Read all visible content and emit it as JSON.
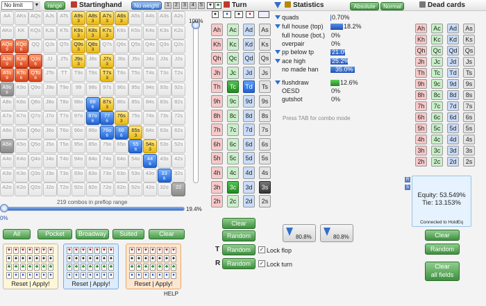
{
  "topbar": {
    "limit_select": "No limit",
    "range_button": "range",
    "starting_hand_title": "Startinghand",
    "weight_button": "No weight",
    "tab_numbers": [
      "1",
      "2",
      "3",
      "4",
      "5"
    ],
    "turn_title": "Turn",
    "statistics_title": "Statistics",
    "absolute_button": "Absolute",
    "normal_button": "Normal",
    "dead_cards_title": "Dead cards"
  },
  "grid": {
    "rows": [
      [
        "AA",
        "AKs",
        "AQs",
        "AJs",
        "ATs",
        "A9s",
        "A8s",
        "A7s",
        "A6s",
        "A5s",
        "A4s",
        "A3s",
        "A2s"
      ],
      [
        "AKo",
        "KK",
        "KQs",
        "KJs",
        "KTs",
        "K9s",
        "K8s",
        "K7s",
        "K6s",
        "K5s",
        "K4s",
        "K3s",
        "K2s"
      ],
      [
        "AQo",
        "KQo",
        "QQ",
        "QJs",
        "QTs",
        "Q9s",
        "Q8s",
        "Q7s",
        "Q6s",
        "Q5s",
        "Q4s",
        "Q3s",
        "Q2s"
      ],
      [
        "AJo",
        "KJo",
        "QJo",
        "JJ",
        "JTs",
        "J9s",
        "J8s",
        "J7s",
        "J6s",
        "J5s",
        "J4s",
        "J3s",
        "J2s"
      ],
      [
        "ATo",
        "KTo",
        "QTo",
        "JTo",
        "TT",
        "T9s",
        "T8s",
        "T7s",
        "T6s",
        "T5s",
        "T4s",
        "T3s",
        "T2s"
      ],
      [
        "A9o",
        "K9o",
        "Q9o",
        "J9o",
        "T9o",
        "99",
        "98s",
        "97s",
        "96s",
        "95s",
        "94s",
        "93s",
        "92s"
      ],
      [
        "A8o",
        "K8o",
        "Q8o",
        "J8o",
        "T8o",
        "98o",
        "88",
        "87s",
        "86s",
        "85s",
        "84s",
        "83s",
        "82s"
      ],
      [
        "A7o",
        "K7o",
        "Q7o",
        "J7o",
        "T7o",
        "97o",
        "87o",
        "77",
        "76s",
        "75s",
        "74s",
        "73s",
        "72s"
      ],
      [
        "A6o",
        "K6o",
        "Q6o",
        "J6o",
        "T6o",
        "96o",
        "86o",
        "76o",
        "66",
        "65s",
        "64s",
        "63s",
        "62s"
      ],
      [
        "A5o",
        "K5o",
        "Q5o",
        "J5o",
        "T5o",
        "95o",
        "85o",
        "75o",
        "65o",
        "55",
        "54s",
        "53s",
        "52s"
      ],
      [
        "A4o",
        "K4o",
        "Q4o",
        "J4o",
        "T4o",
        "94o",
        "84o",
        "74o",
        "64o",
        "54o",
        "44",
        "43s",
        "42s"
      ],
      [
        "A3o",
        "K3o",
        "Q3o",
        "J3o",
        "T3o",
        "93o",
        "83o",
        "73o",
        "63o",
        "53o",
        "43o",
        "33",
        "32s"
      ],
      [
        "A2o",
        "K2o",
        "Q2o",
        "J2o",
        "T2o",
        "92o",
        "82o",
        "72o",
        "62o",
        "52o",
        "42o",
        "32o",
        "22"
      ]
    ],
    "highlighted": [
      {
        "r": 0,
        "c": 5,
        "color": "yellow",
        "count": "3"
      },
      {
        "r": 0,
        "c": 6,
        "color": "yellow",
        "count": "3"
      },
      {
        "r": 0,
        "c": 7,
        "color": "yellow",
        "count": "3"
      },
      {
        "r": 0,
        "c": 8,
        "color": "yellow",
        "count": "3"
      },
      {
        "r": 1,
        "c": 5,
        "color": "yellow",
        "count": "3"
      },
      {
        "r": 1,
        "c": 6,
        "color": "yellow",
        "count": "3"
      },
      {
        "r": 1,
        "c": 7,
        "color": "yellow",
        "count": "3"
      },
      {
        "r": 2,
        "c": 0,
        "color": "orange",
        "count": "9"
      },
      {
        "r": 2,
        "c": 1,
        "color": "orange",
        "count": "6"
      },
      {
        "r": 2,
        "c": 5,
        "color": "yellow",
        "count": "3"
      },
      {
        "r": 2,
        "c": 6,
        "color": "yellow",
        "count": "3"
      },
      {
        "r": 3,
        "c": 0,
        "color": "orange",
        "count": "9"
      },
      {
        "r": 3,
        "c": 1,
        "color": "orange",
        "count": "6"
      },
      {
        "r": 3,
        "c": 2,
        "color": "orange",
        "count": "6"
      },
      {
        "r": 3,
        "c": 5,
        "color": "yellow",
        "count": "3"
      },
      {
        "r": 3,
        "c": 7,
        "color": "yellow",
        "count": "3"
      },
      {
        "r": 4,
        "c": 0,
        "color": "orange",
        "count": "9"
      },
      {
        "r": 4,
        "c": 1,
        "color": "orange",
        "count": "6"
      },
      {
        "r": 4,
        "c": 2,
        "color": "orange",
        "count": "6"
      },
      {
        "r": 4,
        "c": 7,
        "color": "yellow",
        "count": "3"
      },
      {
        "r": 5,
        "c": 0,
        "color": "grayd",
        "count": "6"
      },
      {
        "r": 6,
        "c": 6,
        "color": "blue",
        "count": "6"
      },
      {
        "r": 6,
        "c": 7,
        "color": "yellow",
        "count": "3"
      },
      {
        "r": 7,
        "c": 6,
        "color": "blue",
        "count": "6"
      },
      {
        "r": 7,
        "c": 7,
        "color": "blue",
        "count": "6"
      },
      {
        "r": 7,
        "c": 8,
        "color": "yellow",
        "count": "3"
      },
      {
        "r": 8,
        "c": 7,
        "color": "blue",
        "count": "6"
      },
      {
        "r": 8,
        "c": 8,
        "color": "blue",
        "count": "6"
      },
      {
        "r": 8,
        "c": 9,
        "color": "yellow",
        "count": "3"
      },
      {
        "r": 9,
        "c": 0,
        "color": "grayd",
        "count": ""
      },
      {
        "r": 9,
        "c": 9,
        "color": "blue",
        "count": "6"
      },
      {
        "r": 9,
        "c": 10,
        "color": "yellow",
        "count": "3"
      },
      {
        "r": 10,
        "c": 10,
        "color": "blue",
        "count": "6"
      },
      {
        "r": 11,
        "c": 11,
        "color": "blue",
        "count": "6"
      },
      {
        "r": 12,
        "c": 12,
        "color": "grayd",
        "count": ""
      }
    ],
    "combos_text": "219 combos in preflop range"
  },
  "vslider_pct": "100%",
  "hslider": {
    "left_pct": "0%",
    "right_pct": "19.4%"
  },
  "preset_buttons": [
    "All",
    "Pocket",
    "Broadway",
    "Suited",
    "Clear"
  ],
  "presets": [
    {
      "reset": "Reset",
      "apply": "Apply!"
    },
    {
      "reset": "Reset",
      "apply": "Apply!"
    },
    {
      "reset": "Reset",
      "apply": "Apply!"
    }
  ],
  "help_label": "HELP",
  "turn": {
    "ranks": [
      "A",
      "K",
      "Q",
      "J",
      "T",
      "9",
      "8",
      "7",
      "6",
      "5",
      "4",
      "3",
      "2"
    ],
    "suits": [
      "h",
      "c",
      "d",
      "s"
    ],
    "selected": [
      {
        "rank": "T",
        "suit": "c",
        "style": "sel"
      },
      {
        "rank": "T",
        "suit": "d",
        "style": "seld"
      },
      {
        "rank": "3",
        "suit": "c",
        "style": "sel"
      },
      {
        "rank": "3",
        "suit": "s",
        "style": "selk"
      }
    ],
    "clear_label": "Clear",
    "random_label": "Random",
    "random_flop_label": "Random",
    "random_turn_label": "Random",
    "lock_flop_label": "Lock flop",
    "lock_turn_label": "Lock turn",
    "filter_a_pct": "80.8%",
    "filter_b_pct": "80.8%"
  },
  "statistics": {
    "rows": [
      {
        "name": "quads",
        "value": "0.70%",
        "bar": 0.007,
        "color": "b",
        "marker": true
      },
      {
        "name": "full house (top)",
        "value": "18.2%",
        "bar": 0.182,
        "color": "b",
        "marker": true
      },
      {
        "name": "full house (bot.)",
        "value": "0%",
        "bar": 0,
        "color": "b",
        "marker": false
      },
      {
        "name": "overpair",
        "value": "0%",
        "bar": 0,
        "color": "b",
        "marker": false
      },
      {
        "name": "pp below tp",
        "value": "21.0%",
        "bar": 0.21,
        "color": "b",
        "marker": true
      },
      {
        "name": "ace high",
        "value": "25.2%",
        "bar": 0.252,
        "color": "b",
        "marker": true
      },
      {
        "name": "no made han",
        "value": "35.0%",
        "bar": 0.35,
        "color": "b",
        "marker": false
      },
      {
        "name": "flushdraw",
        "value": "12.6%",
        "bar": 0.126,
        "color": "g",
        "marker": true
      },
      {
        "name": "OESD",
        "value": "0%",
        "bar": 0,
        "color": "b",
        "marker": false
      },
      {
        "name": "gutshot",
        "value": "0%",
        "bar": 0,
        "color": "b",
        "marker": false
      }
    ],
    "hint": "Press TAB for combo mode"
  },
  "dead_cards": {
    "clear_label": "Clear",
    "random_label": "Random",
    "clear_all_label_1": "Clear",
    "clear_all_label_2": "all fields"
  },
  "equity": {
    "equity_text": "Equity: 53.549%",
    "tie_text": "Tie: 13.153%",
    "connected_text": "Connected to HoldEq",
    "side_tabs": [
      "R",
      "S"
    ]
  },
  "colors": {
    "accent_green": "#3e8e3e",
    "accent_blue": "#1e63d6",
    "orange": "#d8431c",
    "yellow": "#e9b810"
  }
}
